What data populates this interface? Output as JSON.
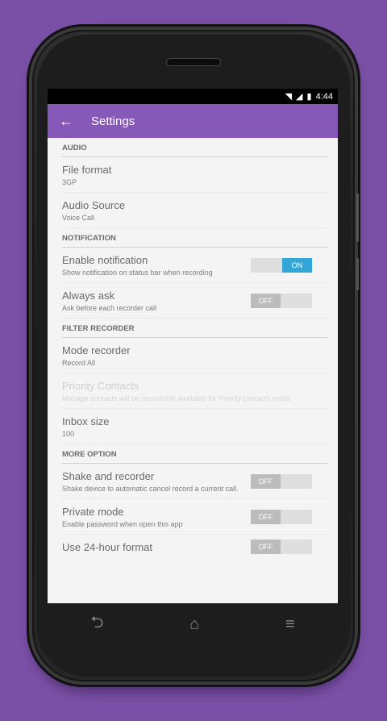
{
  "status": {
    "time": "4:44",
    "wifi_icon": "wifi-icon",
    "signal_icon": "signal-icon",
    "battery_icon": "battery-icon"
  },
  "appbar": {
    "back_glyph": "←",
    "title": "Settings"
  },
  "sections": [
    {
      "title": "AUDIO",
      "items": [
        {
          "title": "File format",
          "subtitle": "3GP"
        },
        {
          "title": "Audio Source",
          "subtitle": "Voice Call"
        }
      ]
    },
    {
      "title": "NOTIFICATION",
      "items": [
        {
          "title": "Enable notification",
          "subtitle": "Show notification on status bar when recording",
          "toggle": "ON"
        },
        {
          "title": "Always ask",
          "subtitle": "Ask before each recorder call",
          "toggle": "OFF"
        }
      ]
    },
    {
      "title": "FILTER RECORDER",
      "items": [
        {
          "title": "Mode recorder",
          "subtitle": "Record All"
        },
        {
          "title": "Priority Contacts",
          "subtitle": "Manage contacts will be recordonly available for Priority contacts mode",
          "disabled": true
        },
        {
          "title": "Inbox size",
          "subtitle": "100"
        }
      ]
    },
    {
      "title": "MORE OPTION",
      "items": [
        {
          "title": "Shake and recorder",
          "subtitle": "Shake device to automatic cancel record a current call.",
          "toggle": "OFF"
        },
        {
          "title": "Private mode",
          "subtitle": "Enable password when open this app",
          "toggle": "OFF"
        },
        {
          "title": "Use 24-hour format",
          "subtitle": "",
          "toggle": "OFF"
        }
      ]
    }
  ],
  "navbar": {
    "back_glyph": "⮌",
    "home_glyph": "⌂",
    "menu_glyph": "≡"
  }
}
